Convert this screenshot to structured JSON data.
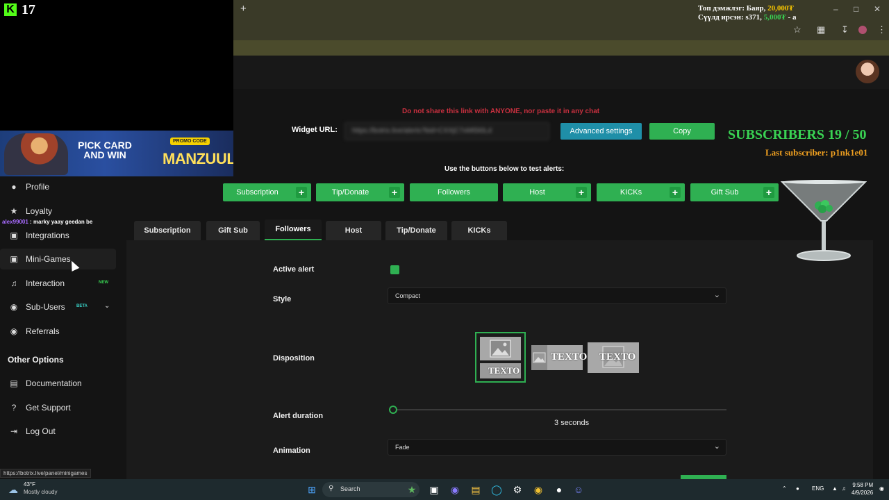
{
  "stream_overlay": {
    "viewer_count": "17",
    "top_donator_line_prefix": "Топ дэмжлэг: Баяр, ",
    "top_donator_amount": "20,000₮",
    "last_donation_prefix": "Сүүлд ирсэн: s371, ",
    "last_donation_amount": "5,000₮",
    "last_donation_suffix": " - a",
    "chat_user": "alex99001",
    "chat_message": " : marky yaay geedan be"
  },
  "promo": {
    "headline": "PICK CARD AND WIN",
    "label": "PROMO CODE",
    "code": "MANZUUL"
  },
  "browser": {
    "new_tab": "+",
    "status_url": "https://botrix.live/panel/minigames"
  },
  "sidebar": {
    "items": [
      {
        "label": "Profile",
        "icon": "profile-icon"
      },
      {
        "label": "Loyalty",
        "icon": "trophy-icon"
      },
      {
        "label": "Integrations",
        "icon": "integrations-icon"
      },
      {
        "label": "Mini-Games",
        "icon": "gamepad-icon"
      },
      {
        "label": "Interaction",
        "icon": "music-icon",
        "badge": "NEW"
      },
      {
        "label": "Sub-Users",
        "icon": "users-icon",
        "badge": "BETA"
      },
      {
        "label": "Referrals",
        "icon": "referrals-icon"
      }
    ],
    "other_heading": "Other Options",
    "other_items": [
      {
        "label": "Documentation",
        "icon": "document-icon"
      },
      {
        "label": "Get Support",
        "icon": "question-icon"
      },
      {
        "label": "Log Out",
        "icon": "logout-icon"
      }
    ]
  },
  "alerts": {
    "warning": "Do not share this link with ANYONE, nor paste it in any chat",
    "widget_url_label": "Widget URL:",
    "widget_url_value": "https://botrix.live/alerts?bid=CXXjC7xMt5t0Ld",
    "advanced_button": "Advanced settings",
    "copy_button": "Copy",
    "test_heading": "Use the buttons below to test alerts:",
    "test_buttons": [
      "Subscription",
      "Tip/Donate",
      "Followers",
      "Host",
      "KICKs",
      "Gift Sub"
    ],
    "tabs": [
      "Subscription",
      "Gift Sub",
      "Followers",
      "Host",
      "Tip/Donate",
      "KICKs"
    ],
    "active_tab": "Followers"
  },
  "subscriber_goal": {
    "title": "SUBSCRIBERS 19 / 50",
    "last": "Last subscriber: p1nk1e01"
  },
  "form": {
    "active_label": "Active alert",
    "style_label": "Style",
    "style_value": "Compact",
    "disposition_label": "Disposition",
    "disposition_text": "TEXTO",
    "duration_label": "Alert duration",
    "duration_value": "3",
    "duration_unit": "seconds",
    "animation_label": "Animation",
    "animation_value": "Fade"
  },
  "taskbar": {
    "temp": "43°F",
    "weather": "Mostly cloudy",
    "search": "Search",
    "lang": "ENG",
    "time": "9:58 PM",
    "date": "4/9/2026"
  },
  "colors": {
    "accent_green": "#2fb052",
    "advanced_blue": "#1f8fa8",
    "warning_red": "#c9303f",
    "goal_green": "#39d353",
    "goal_orange": "#f0a020"
  }
}
